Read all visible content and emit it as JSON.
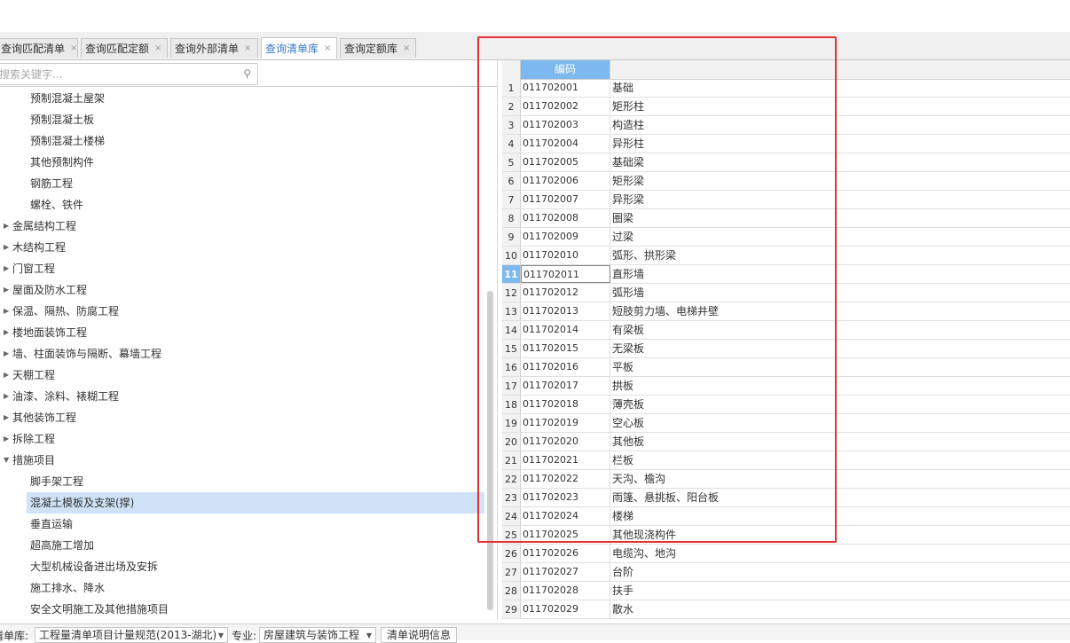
{
  "tabs": [
    {
      "label": "查询匹配清单",
      "active": false
    },
    {
      "label": "查询匹配定额",
      "active": false
    },
    {
      "label": "查询外部清单",
      "active": false
    },
    {
      "label": "查询清单库",
      "active": true
    },
    {
      "label": "查询定额库",
      "active": false
    }
  ],
  "tab_close_glyph": "×",
  "search": {
    "placeholder": "搜索关键字...",
    "value": "",
    "icon": "search-icon"
  },
  "tree": [
    {
      "label": "预制混凝土屋架",
      "level": 1
    },
    {
      "label": "预制混凝土板",
      "level": 1
    },
    {
      "label": "预制混凝土楼梯",
      "level": 1
    },
    {
      "label": "其他预制构件",
      "level": 1
    },
    {
      "label": "钢筋工程",
      "level": 1
    },
    {
      "label": "螺栓、铁件",
      "level": 1
    },
    {
      "label": "金属结构工程",
      "level": 0,
      "expanded": false
    },
    {
      "label": "木结构工程",
      "level": 0,
      "expanded": false
    },
    {
      "label": "门窗工程",
      "level": 0,
      "expanded": false
    },
    {
      "label": "屋面及防水工程",
      "level": 0,
      "expanded": false
    },
    {
      "label": "保温、隔热、防腐工程",
      "level": 0,
      "expanded": false
    },
    {
      "label": "楼地面装饰工程",
      "level": 0,
      "expanded": false
    },
    {
      "label": "墙、柱面装饰与隔断、幕墙工程",
      "level": 0,
      "expanded": false
    },
    {
      "label": "天棚工程",
      "level": 0,
      "expanded": false
    },
    {
      "label": "油漆、涂料、裱糊工程",
      "level": 0,
      "expanded": false
    },
    {
      "label": "其他装饰工程",
      "level": 0,
      "expanded": false
    },
    {
      "label": "拆除工程",
      "level": 0,
      "expanded": false
    },
    {
      "label": "措施项目",
      "level": 0,
      "expanded": true
    },
    {
      "label": "脚手架工程",
      "level": 1
    },
    {
      "label": "混凝土模板及支架(撑)",
      "level": 1,
      "selected": true
    },
    {
      "label": "垂直运输",
      "level": 1
    },
    {
      "label": "超高施工增加",
      "level": 1
    },
    {
      "label": "大型机械设备进出场及安拆",
      "level": 1
    },
    {
      "label": "施工排水、降水",
      "level": 1
    },
    {
      "label": "安全文明施工及其他措施项目",
      "level": 1
    }
  ],
  "table": {
    "header_code": "编码",
    "current_row": 11,
    "rows": [
      {
        "n": "1",
        "code": "011702001",
        "name": "基础"
      },
      {
        "n": "2",
        "code": "011702002",
        "name": "矩形柱"
      },
      {
        "n": "3",
        "code": "011702003",
        "name": "构造柱"
      },
      {
        "n": "4",
        "code": "011702004",
        "name": "异形柱"
      },
      {
        "n": "5",
        "code": "011702005",
        "name": "基础梁"
      },
      {
        "n": "6",
        "code": "011702006",
        "name": "矩形梁"
      },
      {
        "n": "7",
        "code": "011702007",
        "name": "异形梁"
      },
      {
        "n": "8",
        "code": "011702008",
        "name": "圈梁"
      },
      {
        "n": "9",
        "code": "011702009",
        "name": "过梁"
      },
      {
        "n": "10",
        "code": "011702010",
        "name": "弧形、拱形梁"
      },
      {
        "n": "11",
        "code": "011702011",
        "name": "直形墙"
      },
      {
        "n": "12",
        "code": "011702012",
        "name": "弧形墙"
      },
      {
        "n": "13",
        "code": "011702013",
        "name": "短肢剪力墙、电梯井壁"
      },
      {
        "n": "14",
        "code": "011702014",
        "name": "有梁板"
      },
      {
        "n": "15",
        "code": "011702015",
        "name": "无梁板"
      },
      {
        "n": "16",
        "code": "011702016",
        "name": "平板"
      },
      {
        "n": "17",
        "code": "011702017",
        "name": "拱板"
      },
      {
        "n": "18",
        "code": "011702018",
        "name": "薄壳板"
      },
      {
        "n": "19",
        "code": "011702019",
        "name": "空心板"
      },
      {
        "n": "20",
        "code": "011702020",
        "name": "其他板"
      },
      {
        "n": "21",
        "code": "011702021",
        "name": "栏板"
      },
      {
        "n": "22",
        "code": "011702022",
        "name": "天沟、檐沟"
      },
      {
        "n": "23",
        "code": "011702023",
        "name": "雨篷、悬挑板、阳台板"
      },
      {
        "n": "24",
        "code": "011702024",
        "name": "楼梯"
      },
      {
        "n": "25",
        "code": "011702025",
        "name": "其他现浇构件"
      },
      {
        "n": "26",
        "code": "011702026",
        "name": "电缆沟、地沟"
      },
      {
        "n": "27",
        "code": "011702027",
        "name": "台阶"
      },
      {
        "n": "28",
        "code": "011702028",
        "name": "扶手"
      },
      {
        "n": "29",
        "code": "011702029",
        "name": "散水"
      }
    ]
  },
  "bottom": {
    "library_label": "清单库:",
    "library_value": "工程量清单项目计量规范(2013-湖北)",
    "specialty_label": "专业:",
    "specialty_value": "房屋建筑与装饰工程",
    "info_button": "清单说明信息"
  },
  "colors": {
    "accent": "#7db9ee",
    "highlight_box": "#e53333",
    "selected_row": "#cfe2f7"
  }
}
